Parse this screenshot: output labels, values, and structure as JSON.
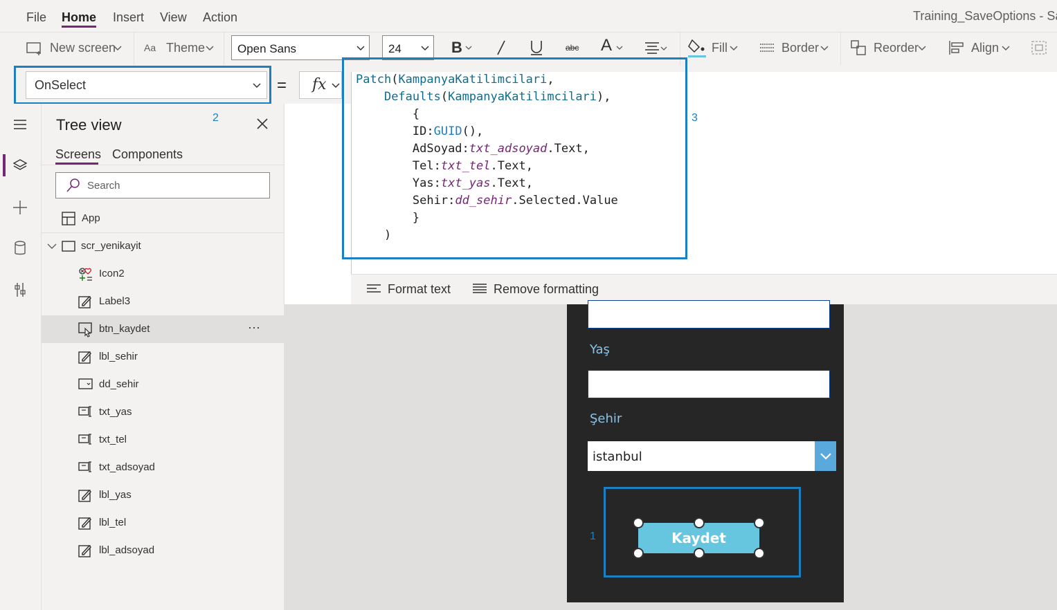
{
  "menu": {
    "items": [
      "File",
      "Home",
      "Insert",
      "View",
      "Action"
    ],
    "active": "Home"
  },
  "document_title": "Training_SaveOptions - Sav",
  "toolbar": {
    "new_screen": "New screen",
    "theme": "Theme",
    "font_family": "Open Sans",
    "font_size": "24",
    "fill": "Fill",
    "border": "Border",
    "reorder": "Reorder",
    "align": "Align"
  },
  "formula_bar": {
    "property": "OnSelect",
    "equals": "=",
    "fx_label": "fx",
    "code_lines": [
      "Patch(KampanyaKatilimcilari,",
      "    Defaults(KampanyaKatilimcilari),",
      "        {",
      "        ID:GUID(),",
      "        AdSoyad:txt_adsoyad.Text,",
      "        Tel:txt_tel.Text,",
      "        Yas:txt_yas.Text,",
      "        Sehir:dd_sehir.Selected.Value",
      "        }",
      "    )"
    ],
    "format_text": "Format text",
    "remove_formatting": "Remove formatting"
  },
  "annotations": {
    "one": "1",
    "two": "2",
    "three": "3"
  },
  "tree_view": {
    "title": "Tree view",
    "tabs": [
      "Screens",
      "Components"
    ],
    "active_tab": "Screens",
    "search_placeholder": "Search",
    "app": "App",
    "screen": "scr_yenikayit",
    "items": [
      {
        "label": "Icon2",
        "icon": "icons-icon"
      },
      {
        "label": "Label3",
        "icon": "label-icon"
      },
      {
        "label": "btn_kaydet",
        "icon": "button-icon",
        "selected": true,
        "more": "···"
      },
      {
        "label": "lbl_sehir",
        "icon": "label-icon"
      },
      {
        "label": "dd_sehir",
        "icon": "dropdown-icon"
      },
      {
        "label": "txt_yas",
        "icon": "text-input-icon"
      },
      {
        "label": "txt_tel",
        "icon": "text-input-icon"
      },
      {
        "label": "txt_adsoyad",
        "icon": "text-input-icon"
      },
      {
        "label": "lbl_yas",
        "icon": "label-icon"
      },
      {
        "label": "lbl_tel",
        "icon": "label-icon"
      },
      {
        "label": "lbl_adsoyad",
        "icon": "label-icon"
      }
    ]
  },
  "app_preview": {
    "label_yas": "Yaş",
    "label_sehir": "Şehir",
    "dropdown_value": "istanbul",
    "button_label": "Kaydet"
  },
  "colors": {
    "accent": "#742774",
    "highlight": "#1b7fc2",
    "button": "#66c6e0",
    "phone_bg": "#262626"
  }
}
